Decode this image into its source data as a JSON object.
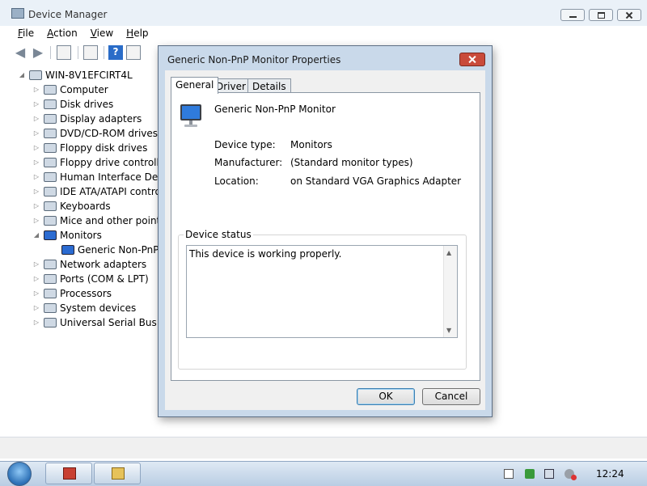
{
  "device_manager": {
    "title": "Device Manager",
    "menu": [
      "File",
      "Action",
      "View",
      "Help"
    ],
    "tree": {
      "root": "WIN-8V1EFCIRT4L",
      "items": [
        {
          "label": "Computer",
          "expanded": false
        },
        {
          "label": "Disk drives",
          "expanded": false
        },
        {
          "label": "Display adapters",
          "expanded": false
        },
        {
          "label": "DVD/CD-ROM drives",
          "expanded": false
        },
        {
          "label": "Floppy disk drives",
          "expanded": false
        },
        {
          "label": "Floppy drive controllers",
          "expanded": false
        },
        {
          "label": "Human Interface Devices",
          "expanded": false
        },
        {
          "label": "IDE ATA/ATAPI controllers",
          "expanded": false
        },
        {
          "label": "Keyboards",
          "expanded": false
        },
        {
          "label": "Mice and other pointing devices",
          "expanded": false
        },
        {
          "label": "Monitors",
          "expanded": true
        },
        {
          "label": "Generic Non-PnP Monitor",
          "child": true
        },
        {
          "label": "Network adapters",
          "expanded": false
        },
        {
          "label": "Ports (COM & LPT)",
          "expanded": false
        },
        {
          "label": "Processors",
          "expanded": false
        },
        {
          "label": "System devices",
          "expanded": false
        },
        {
          "label": "Universal Serial Bus controllers",
          "expanded": false
        }
      ]
    }
  },
  "dialog": {
    "title": "Generic Non-PnP Monitor Properties",
    "tabs": [
      "General",
      "Driver",
      "Details"
    ],
    "active_tab": "General",
    "device_name": "Generic Non-PnP Monitor",
    "properties": [
      {
        "label": "Device type:",
        "value": "Monitors"
      },
      {
        "label": "Manufacturer:",
        "value": "(Standard monitor types)"
      },
      {
        "label": "Location:",
        "value": "on Standard VGA Graphics Adapter"
      }
    ],
    "status_group_label": "Device status",
    "status_text": "This device is working properly.",
    "ok_label": "OK",
    "cancel_label": "Cancel"
  },
  "taskbar": {
    "clock": "12:24"
  }
}
